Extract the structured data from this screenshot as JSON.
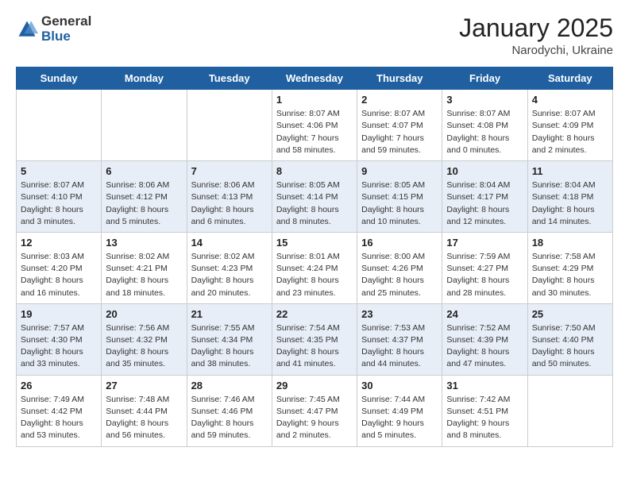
{
  "logo": {
    "general": "General",
    "blue": "Blue"
  },
  "title": {
    "month": "January 2025",
    "location": "Narodychi, Ukraine"
  },
  "weekdays": [
    "Sunday",
    "Monday",
    "Tuesday",
    "Wednesday",
    "Thursday",
    "Friday",
    "Saturday"
  ],
  "weeks": [
    [
      {
        "day": "",
        "info": ""
      },
      {
        "day": "",
        "info": ""
      },
      {
        "day": "",
        "info": ""
      },
      {
        "day": "1",
        "info": "Sunrise: 8:07 AM\nSunset: 4:06 PM\nDaylight: 7 hours\nand 58 minutes."
      },
      {
        "day": "2",
        "info": "Sunrise: 8:07 AM\nSunset: 4:07 PM\nDaylight: 7 hours\nand 59 minutes."
      },
      {
        "day": "3",
        "info": "Sunrise: 8:07 AM\nSunset: 4:08 PM\nDaylight: 8 hours\nand 0 minutes."
      },
      {
        "day": "4",
        "info": "Sunrise: 8:07 AM\nSunset: 4:09 PM\nDaylight: 8 hours\nand 2 minutes."
      }
    ],
    [
      {
        "day": "5",
        "info": "Sunrise: 8:07 AM\nSunset: 4:10 PM\nDaylight: 8 hours\nand 3 minutes."
      },
      {
        "day": "6",
        "info": "Sunrise: 8:06 AM\nSunset: 4:12 PM\nDaylight: 8 hours\nand 5 minutes."
      },
      {
        "day": "7",
        "info": "Sunrise: 8:06 AM\nSunset: 4:13 PM\nDaylight: 8 hours\nand 6 minutes."
      },
      {
        "day": "8",
        "info": "Sunrise: 8:05 AM\nSunset: 4:14 PM\nDaylight: 8 hours\nand 8 minutes."
      },
      {
        "day": "9",
        "info": "Sunrise: 8:05 AM\nSunset: 4:15 PM\nDaylight: 8 hours\nand 10 minutes."
      },
      {
        "day": "10",
        "info": "Sunrise: 8:04 AM\nSunset: 4:17 PM\nDaylight: 8 hours\nand 12 minutes."
      },
      {
        "day": "11",
        "info": "Sunrise: 8:04 AM\nSunset: 4:18 PM\nDaylight: 8 hours\nand 14 minutes."
      }
    ],
    [
      {
        "day": "12",
        "info": "Sunrise: 8:03 AM\nSunset: 4:20 PM\nDaylight: 8 hours\nand 16 minutes."
      },
      {
        "day": "13",
        "info": "Sunrise: 8:02 AM\nSunset: 4:21 PM\nDaylight: 8 hours\nand 18 minutes."
      },
      {
        "day": "14",
        "info": "Sunrise: 8:02 AM\nSunset: 4:23 PM\nDaylight: 8 hours\nand 20 minutes."
      },
      {
        "day": "15",
        "info": "Sunrise: 8:01 AM\nSunset: 4:24 PM\nDaylight: 8 hours\nand 23 minutes."
      },
      {
        "day": "16",
        "info": "Sunrise: 8:00 AM\nSunset: 4:26 PM\nDaylight: 8 hours\nand 25 minutes."
      },
      {
        "day": "17",
        "info": "Sunrise: 7:59 AM\nSunset: 4:27 PM\nDaylight: 8 hours\nand 28 minutes."
      },
      {
        "day": "18",
        "info": "Sunrise: 7:58 AM\nSunset: 4:29 PM\nDaylight: 8 hours\nand 30 minutes."
      }
    ],
    [
      {
        "day": "19",
        "info": "Sunrise: 7:57 AM\nSunset: 4:30 PM\nDaylight: 8 hours\nand 33 minutes."
      },
      {
        "day": "20",
        "info": "Sunrise: 7:56 AM\nSunset: 4:32 PM\nDaylight: 8 hours\nand 35 minutes."
      },
      {
        "day": "21",
        "info": "Sunrise: 7:55 AM\nSunset: 4:34 PM\nDaylight: 8 hours\nand 38 minutes."
      },
      {
        "day": "22",
        "info": "Sunrise: 7:54 AM\nSunset: 4:35 PM\nDaylight: 8 hours\nand 41 minutes."
      },
      {
        "day": "23",
        "info": "Sunrise: 7:53 AM\nSunset: 4:37 PM\nDaylight: 8 hours\nand 44 minutes."
      },
      {
        "day": "24",
        "info": "Sunrise: 7:52 AM\nSunset: 4:39 PM\nDaylight: 8 hours\nand 47 minutes."
      },
      {
        "day": "25",
        "info": "Sunrise: 7:50 AM\nSunset: 4:40 PM\nDaylight: 8 hours\nand 50 minutes."
      }
    ],
    [
      {
        "day": "26",
        "info": "Sunrise: 7:49 AM\nSunset: 4:42 PM\nDaylight: 8 hours\nand 53 minutes."
      },
      {
        "day": "27",
        "info": "Sunrise: 7:48 AM\nSunset: 4:44 PM\nDaylight: 8 hours\nand 56 minutes."
      },
      {
        "day": "28",
        "info": "Sunrise: 7:46 AM\nSunset: 4:46 PM\nDaylight: 8 hours\nand 59 minutes."
      },
      {
        "day": "29",
        "info": "Sunrise: 7:45 AM\nSunset: 4:47 PM\nDaylight: 9 hours\nand 2 minutes."
      },
      {
        "day": "30",
        "info": "Sunrise: 7:44 AM\nSunset: 4:49 PM\nDaylight: 9 hours\nand 5 minutes."
      },
      {
        "day": "31",
        "info": "Sunrise: 7:42 AM\nSunset: 4:51 PM\nDaylight: 9 hours\nand 8 minutes."
      },
      {
        "day": "",
        "info": ""
      }
    ]
  ]
}
